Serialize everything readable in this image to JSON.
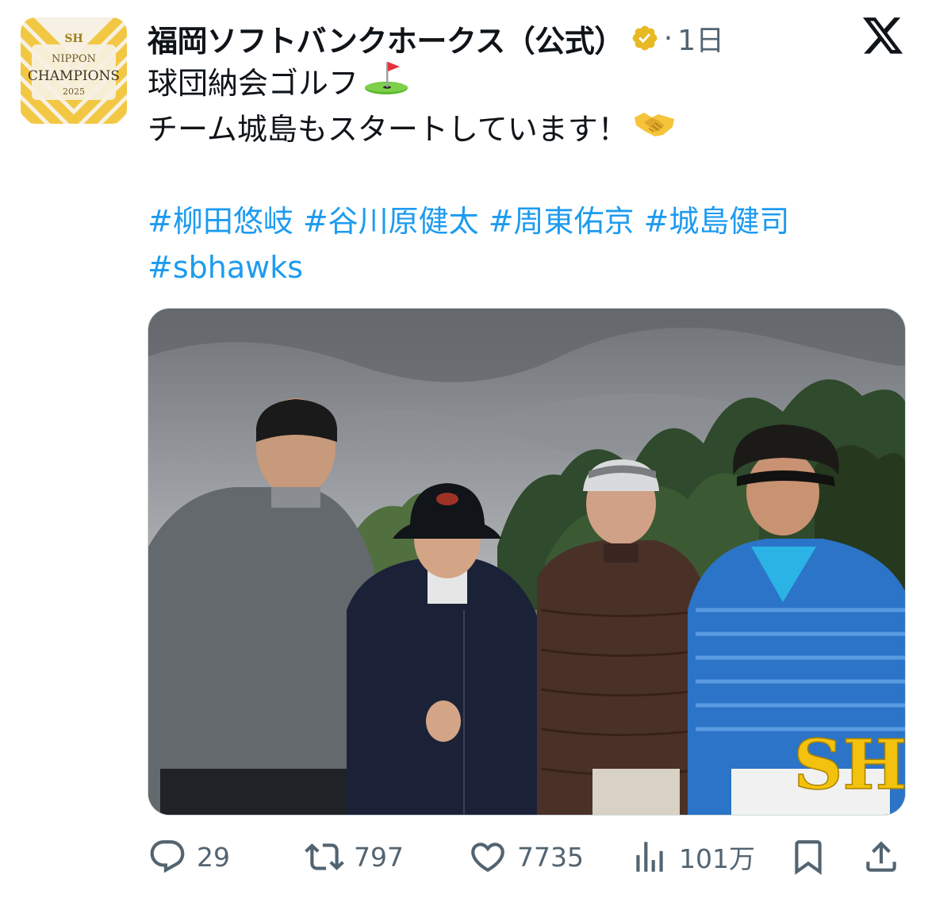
{
  "account": {
    "display_name": "福岡ソフトバンクホークス（公式）",
    "separator": "·",
    "time_ago": "1日",
    "avatar": {
      "top_text": "NIPPON",
      "main_text": "CHAMPIONS",
      "year_text": "2025",
      "colors": {
        "stripe_gold": "#f2c744",
        "stripe_light": "#f7f1e3"
      }
    }
  },
  "tweet": {
    "lines": [
      {
        "text": "球団納会ゴルフ",
        "emoji": "golf-flag"
      },
      {
        "text": "チーム城島もスタートしています！",
        "emoji": "handshake"
      }
    ],
    "hashtags": [
      "#柳田悠岐",
      "#谷川原健太",
      "#周東佑京",
      "#城島健司",
      "#sbhawks"
    ]
  },
  "photo": {
    "watermark": "SH",
    "description_icon": "group-photo-four-golfers"
  },
  "actions": {
    "reply_count": "29",
    "retweet_count": "797",
    "like_count": "7735",
    "views_count": "101万"
  },
  "colors": {
    "text_primary": "#0f1419",
    "text_secondary": "#536471",
    "link": "#1d9bf0",
    "verified_gold": "#e8b923"
  },
  "icons": {
    "platform": "x-logo-icon",
    "verified": "verified-badge-icon",
    "reply": "reply-icon",
    "retweet": "retweet-icon",
    "like": "heart-icon",
    "views": "views-icon",
    "bookmark": "bookmark-icon",
    "share": "share-icon"
  }
}
